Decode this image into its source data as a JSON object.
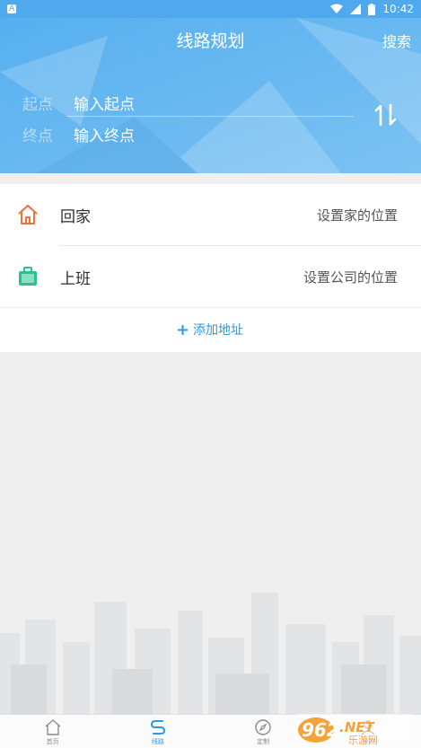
{
  "status_bar": {
    "left_glyph": "A",
    "time": "10:42"
  },
  "header": {
    "title": "线路规划",
    "search_label": "搜索"
  },
  "route": {
    "start_label": "起点",
    "start_placeholder": "输入起点",
    "end_label": "终点",
    "end_placeholder": "输入终点"
  },
  "shortcuts": [
    {
      "name": "回家",
      "hint": "设置家的位置",
      "icon": "home-icon",
      "color": "#f06f3c"
    },
    {
      "name": "上班",
      "hint": "设置公司的位置",
      "icon": "briefcase-icon",
      "color": "#2cc08f"
    }
  ],
  "add_address_label": "添加地址",
  "tabs": [
    {
      "label": "首页",
      "icon": "home-outline-icon"
    },
    {
      "label": "线路",
      "icon": "route-icon",
      "active": true
    },
    {
      "label": "定制",
      "icon": "compass-icon"
    },
    {
      "label": "我的",
      "icon": "user-icon"
    }
  ],
  "watermark": {
    "text": "962.NET",
    "subtext": "乐游网"
  },
  "colors": {
    "header_blue": "#56b0ef",
    "accent": "#2a9ae8"
  }
}
